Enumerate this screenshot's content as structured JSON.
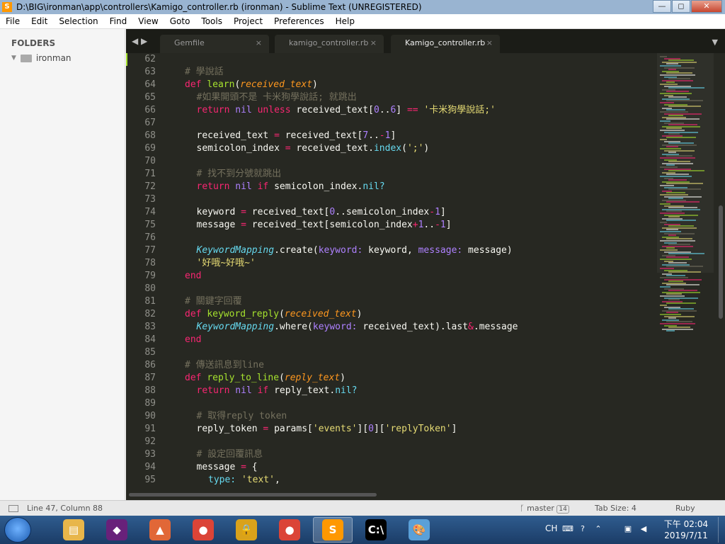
{
  "window": {
    "title": "D:\\BIG\\ironman\\app\\controllers\\Kamigo_controller.rb (ironman) - Sublime Text (UNREGISTERED)",
    "app_icon": "sublime-icon",
    "buttons": {
      "minimize": "—",
      "maximize": "◻",
      "close": "✕"
    }
  },
  "menu": [
    "File",
    "Edit",
    "Selection",
    "Find",
    "View",
    "Goto",
    "Tools",
    "Project",
    "Preferences",
    "Help"
  ],
  "sidebar": {
    "header": "FOLDERS",
    "folder": "ironman"
  },
  "tabs": [
    {
      "label": "Gemfile",
      "close": "×",
      "active": false
    },
    {
      "label": "kamigo_controller.rb",
      "close": "×",
      "active": false
    },
    {
      "label": "Kamigo_controller.rb",
      "close": "×",
      "active": true
    }
  ],
  "tabnav": "◀ ▶",
  "tab_dropdown": "▼",
  "code": {
    "line_numbers": [
      "62",
      "63",
      "64",
      "65",
      "66",
      "67",
      "68",
      "69",
      "70",
      "71",
      "72",
      "73",
      "74",
      "75",
      "76",
      "77",
      "78",
      "79",
      "80",
      "81",
      "82",
      "83",
      "84",
      "85",
      "86",
      "87",
      "88",
      "89",
      "90",
      "91",
      "92",
      "93",
      "94",
      "95"
    ],
    "lines": [
      [],
      [
        {
          "t": "# 學說話",
          "c": "t-c",
          "i": 1
        }
      ],
      [
        {
          "t": "def ",
          "c": "t-k",
          "i": 1
        },
        {
          "t": "learn",
          "c": "t-f"
        },
        {
          "t": "("
        },
        {
          "t": "received_text",
          "c": "t-p"
        },
        {
          "t": ")"
        }
      ],
      [
        {
          "t": "#如果開頭不是 卡米狗學說話; 就跳出",
          "c": "t-c",
          "i": 2
        }
      ],
      [
        {
          "t": "return ",
          "c": "t-k",
          "i": 2
        },
        {
          "t": "nil",
          "c": "t-n"
        },
        {
          "t": " unless ",
          "c": "t-k"
        },
        {
          "t": "received_text["
        },
        {
          "t": "0",
          "c": "t-n"
        },
        {
          "t": ".."
        },
        {
          "t": "6",
          "c": "t-n"
        },
        {
          "t": "] "
        },
        {
          "t": "==",
          "c": "t-k"
        },
        {
          "t": " "
        },
        {
          "t": "'卡米狗學說話;'",
          "c": "t-s"
        }
      ],
      [],
      [
        {
          "t": "received_text ",
          "i": 2
        },
        {
          "t": "=",
          "c": "t-k"
        },
        {
          "t": " received_text["
        },
        {
          "t": "7",
          "c": "t-n"
        },
        {
          "t": ".."
        },
        {
          "t": "-",
          "c": "t-k"
        },
        {
          "t": "1",
          "c": "t-n"
        },
        {
          "t": "]"
        }
      ],
      [
        {
          "t": "semicolon_index ",
          "i": 2
        },
        {
          "t": "=",
          "c": "t-k"
        },
        {
          "t": " received_text."
        },
        {
          "t": "index",
          "c": "t-m"
        },
        {
          "t": "("
        },
        {
          "t": "';'",
          "c": "t-s"
        },
        {
          "t": ")"
        }
      ],
      [],
      [
        {
          "t": "# 找不到分號就跳出",
          "c": "t-c",
          "i": 2
        }
      ],
      [
        {
          "t": "return ",
          "c": "t-k",
          "i": 2
        },
        {
          "t": "nil",
          "c": "t-n"
        },
        {
          "t": " if ",
          "c": "t-k"
        },
        {
          "t": "semicolon_index."
        },
        {
          "t": "nil?",
          "c": "t-m"
        }
      ],
      [],
      [
        {
          "t": "keyword ",
          "i": 2
        },
        {
          "t": "=",
          "c": "t-k"
        },
        {
          "t": " received_text["
        },
        {
          "t": "0",
          "c": "t-n"
        },
        {
          "t": ".."
        },
        {
          "t": "semicolon_index"
        },
        {
          "t": "-",
          "c": "t-k"
        },
        {
          "t": "1",
          "c": "t-n"
        },
        {
          "t": "]"
        }
      ],
      [
        {
          "t": "message ",
          "i": 2
        },
        {
          "t": "=",
          "c": "t-k"
        },
        {
          "t": " received_text[semicolon_index"
        },
        {
          "t": "+",
          "c": "t-k"
        },
        {
          "t": "1",
          "c": "t-n"
        },
        {
          "t": ".."
        },
        {
          "t": "-",
          "c": "t-k"
        },
        {
          "t": "1",
          "c": "t-n"
        },
        {
          "t": "]"
        }
      ],
      [],
      [
        {
          "t": "KeywordMapping",
          "c": "t-i",
          "i": 2
        },
        {
          "t": ".create("
        },
        {
          "t": "keyword:",
          "c": "t-n"
        },
        {
          "t": " keyword, "
        },
        {
          "t": "message:",
          "c": "t-n"
        },
        {
          "t": " message)"
        }
      ],
      [
        {
          "t": "'好哦~好哦~'",
          "c": "t-s",
          "i": 2
        }
      ],
      [
        {
          "t": "end",
          "c": "t-k",
          "i": 1
        }
      ],
      [],
      [
        {
          "t": "# 關鍵字回覆",
          "c": "t-c",
          "i": 1
        }
      ],
      [
        {
          "t": "def ",
          "c": "t-k",
          "i": 1
        },
        {
          "t": "keyword_reply",
          "c": "t-f"
        },
        {
          "t": "("
        },
        {
          "t": "received_text",
          "c": "t-p"
        },
        {
          "t": ")"
        }
      ],
      [
        {
          "t": "KeywordMapping",
          "c": "t-i",
          "i": 2
        },
        {
          "t": ".where("
        },
        {
          "t": "keyword:",
          "c": "t-n"
        },
        {
          "t": " received_text).last"
        },
        {
          "t": "&",
          "c": "t-k"
        },
        {
          "t": ".message"
        }
      ],
      [
        {
          "t": "end",
          "c": "t-k",
          "i": 1
        }
      ],
      [],
      [
        {
          "t": "# 傳送訊息到line",
          "c": "t-c",
          "i": 1
        }
      ],
      [
        {
          "t": "def ",
          "c": "t-k",
          "i": 1
        },
        {
          "t": "reply_to_line",
          "c": "t-f"
        },
        {
          "t": "("
        },
        {
          "t": "reply_text",
          "c": "t-p"
        },
        {
          "t": ")"
        }
      ],
      [
        {
          "t": "return ",
          "c": "t-k",
          "i": 2
        },
        {
          "t": "nil",
          "c": "t-n"
        },
        {
          "t": " if ",
          "c": "t-k"
        },
        {
          "t": "reply_text."
        },
        {
          "t": "nil?",
          "c": "t-m"
        }
      ],
      [],
      [
        {
          "t": "# 取得reply token",
          "c": "t-c",
          "i": 2
        }
      ],
      [
        {
          "t": "reply_token ",
          "i": 2
        },
        {
          "t": "=",
          "c": "t-k"
        },
        {
          "t": " params["
        },
        {
          "t": "'events'",
          "c": "t-s"
        },
        {
          "t": "]["
        },
        {
          "t": "0",
          "c": "t-n"
        },
        {
          "t": "]["
        },
        {
          "t": "'replyToken'",
          "c": "t-s"
        },
        {
          "t": "]"
        }
      ],
      [],
      [
        {
          "t": "# 設定回覆訊息",
          "c": "t-c",
          "i": 2
        }
      ],
      [
        {
          "t": "message ",
          "i": 2
        },
        {
          "t": "=",
          "c": "t-k"
        },
        {
          "t": " {"
        }
      ],
      [
        {
          "t": "type:",
          "c": "t-m",
          "i": 3
        },
        {
          "t": " "
        },
        {
          "t": "'text'",
          "c": "t-s"
        },
        {
          "t": ","
        }
      ]
    ]
  },
  "status": {
    "position": "Line 47, Column 88",
    "branch_icon": "branch-icon",
    "branch": "master",
    "changes": "14",
    "tab_size": "Tab Size: 4",
    "syntax": "Ruby"
  },
  "taskbar": {
    "apps": [
      {
        "name": "explorer-icon",
        "glyph": "▤",
        "color": "#e8b64a"
      },
      {
        "name": "visual-studio-icon",
        "glyph": "◆",
        "color": "#68217a"
      },
      {
        "name": "matlab-icon",
        "glyph": "▲",
        "color": "#e16737"
      },
      {
        "name": "chrome-icon",
        "glyph": "●",
        "color": "#db4437"
      },
      {
        "name": "keepass-icon",
        "glyph": "🔒",
        "color": "#d9a21b"
      },
      {
        "name": "chrome-icon-2",
        "glyph": "●",
        "color": "#db4437"
      },
      {
        "name": "sublime-taskbar-icon",
        "glyph": "S",
        "color": "#ff9800"
      },
      {
        "name": "cmd-icon",
        "glyph": "C:\\",
        "color": "#000000"
      },
      {
        "name": "paint-icon",
        "glyph": "🎨",
        "color": "#5aa0d8"
      }
    ],
    "lang": "CH",
    "clock_time": "下午 02:04",
    "clock_date": "2019/7/11"
  },
  "colors": {
    "editor_bg": "#272822",
    "accent": "#a6e22e"
  }
}
